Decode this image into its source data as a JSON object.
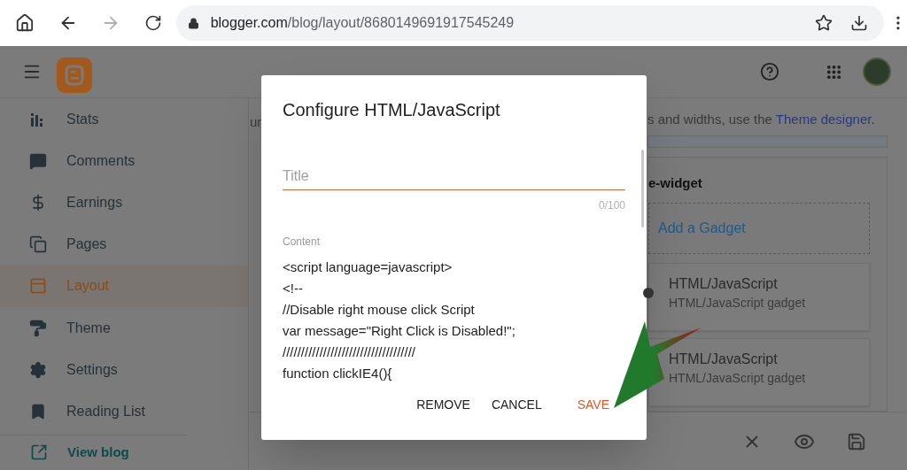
{
  "browser": {
    "host": "blogger.com",
    "path": "/blog/layout/8680149691917545249",
    "forward_disabled": true
  },
  "sidebar": {
    "items": [
      {
        "label": "Stats",
        "kind": "stats",
        "selected": false
      },
      {
        "label": "Comments",
        "kind": "comments",
        "selected": false
      },
      {
        "label": "Earnings",
        "kind": "earnings",
        "selected": false
      },
      {
        "label": "Pages",
        "kind": "pages",
        "selected": false
      },
      {
        "label": "Layout",
        "kind": "layout",
        "selected": true
      },
      {
        "label": "Theme",
        "kind": "theme",
        "selected": false
      },
      {
        "label": "Settings",
        "kind": "settings",
        "selected": false
      },
      {
        "label": "Reading List",
        "kind": "reading",
        "selected": false
      }
    ],
    "footer_link": "View blog"
  },
  "page": {
    "intro_left": "ur",
    "intro_right": "s and widths, use the ",
    "intro_link": "Theme designer",
    "intro_end": ".",
    "section": {
      "title": "e-widget",
      "add_gadget": "Add a Gadget",
      "gadgets": [
        {
          "title": "HTML/JavaScript",
          "subtitle": "HTML/JavaScript gadget"
        },
        {
          "title": "HTML/JavaScript",
          "subtitle": "HTML/JavaScript gadget"
        }
      ]
    }
  },
  "dialog": {
    "title": "Configure HTML/JavaScript",
    "title_field": {
      "placeholder": "Title",
      "counter": "0/100"
    },
    "content_label": "Content",
    "content_lines": [
      "<script language=javascript>",
      "<!--",
      "//Disable right mouse click Script",
      "var message=\"Right Click is Disabled!\";",
      "////////////////////////////////////",
      "function clickIE4(){"
    ],
    "buttons": [
      {
        "label": "REMOVE",
        "kind": "text"
      },
      {
        "label": "CANCEL",
        "kind": "text"
      },
      {
        "label": "SAVE",
        "kind": "primary"
      }
    ]
  }
}
